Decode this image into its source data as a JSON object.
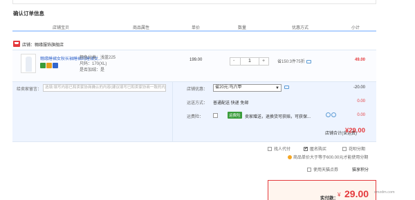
{
  "page": {
    "title": "确认订单信息"
  },
  "table_headers": [
    "店铺宝贝",
    "商品属性",
    "单价",
    "数量",
    "优惠方式",
    "小计"
  ],
  "shop": {
    "label": "店铺：",
    "name": "翱缘服饰旗舰店"
  },
  "item": {
    "title": "翱缘睡裙女秋长袖睡裙纯睡裙女...",
    "attributes": [
      "颜色分类：浅蓝225",
      "尺码：170(XL)",
      "是否加绒：是"
    ],
    "unit_price": "199.00",
    "quantity": "1",
    "qty_minus": "-",
    "qty_plus": "+",
    "discount": "省150:3件75折",
    "subtotal": "49.00"
  },
  "options": {
    "note_label": "给卖家留言：",
    "note_placeholder": "选填:填写内容已和卖家协商确认的内容(建议填写已和卖家协商一致的内容)",
    "shop_discount_label": "店铺优惠：",
    "shop_discount_value": "省20元:马六甲",
    "shop_discount_amount": "-20.00",
    "shipping_label": "运送方式：",
    "shipping_value": "普通配送 快递 免邮",
    "shipping_amount": "0.00",
    "insurance_label": "运费险：",
    "insurance_badge": "运费险",
    "insurance_text": "卖家赠送，退换货可获赔，可获保...",
    "insurance_amount": "0.00",
    "shop_total_label": "店铺合计(含运费)",
    "shop_total": "¥29.00"
  },
  "payment": {
    "anonymous": "匿名购买",
    "proxy": "找人代付",
    "installment": "花呗分期",
    "hint": "商品单价大于等于600.00元才能使用分期",
    "tmall_points": "使用天猫点券",
    "installment_link": "猫享积分",
    "pay_label": "实付款：",
    "pay_currency": "¥",
    "pay_amount": "29.00"
  },
  "watermark": "smzdm.com",
  "colors": {
    "accent": "#e4393c",
    "link": "#3366cc",
    "header_line": "#b2d1ff",
    "panel": "#eef4ff"
  }
}
